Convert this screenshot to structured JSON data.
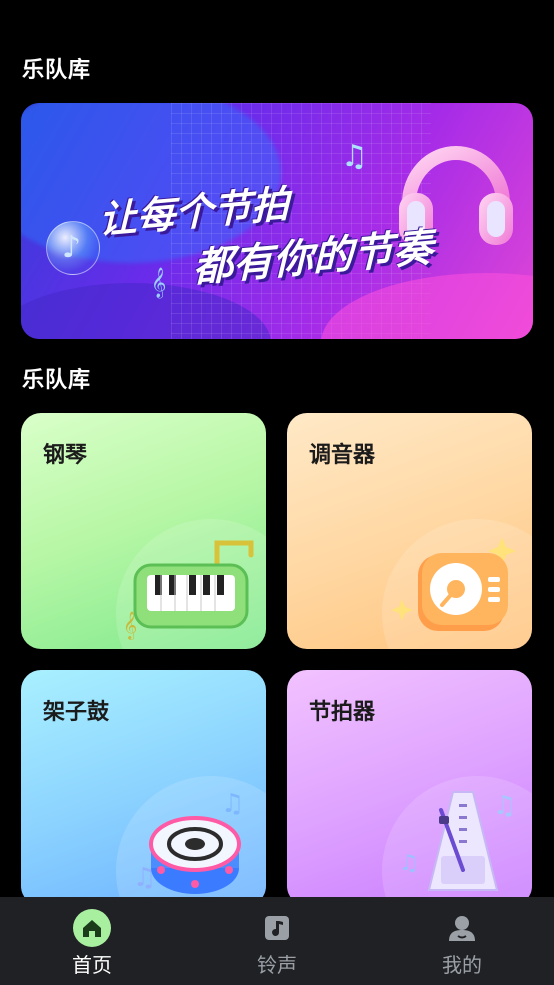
{
  "sections": {
    "top_title": "乐队库",
    "list_title": "乐队库"
  },
  "banner": {
    "line1": "让每个节拍",
    "line2": "都有你的节奏"
  },
  "tiles": [
    {
      "label": "钢琴",
      "icon": "piano-icon"
    },
    {
      "label": "调音器",
      "icon": "turntable-icon"
    },
    {
      "label": "架子鼓",
      "icon": "drum-icon"
    },
    {
      "label": "节拍器",
      "icon": "metronome-icon"
    }
  ],
  "tabbar": {
    "items": [
      {
        "label": "首页",
        "icon": "home-icon",
        "active": true
      },
      {
        "label": "铃声",
        "icon": "music-note-icon",
        "active": false
      },
      {
        "label": "我的",
        "icon": "user-icon",
        "active": false
      }
    ]
  },
  "colors": {
    "background": "#000000",
    "tabbar_bg": "#202124",
    "active_tab": "#ffffff",
    "inactive_tab": "#9aa0a6",
    "home_icon_bg": "#a8f0a0"
  }
}
